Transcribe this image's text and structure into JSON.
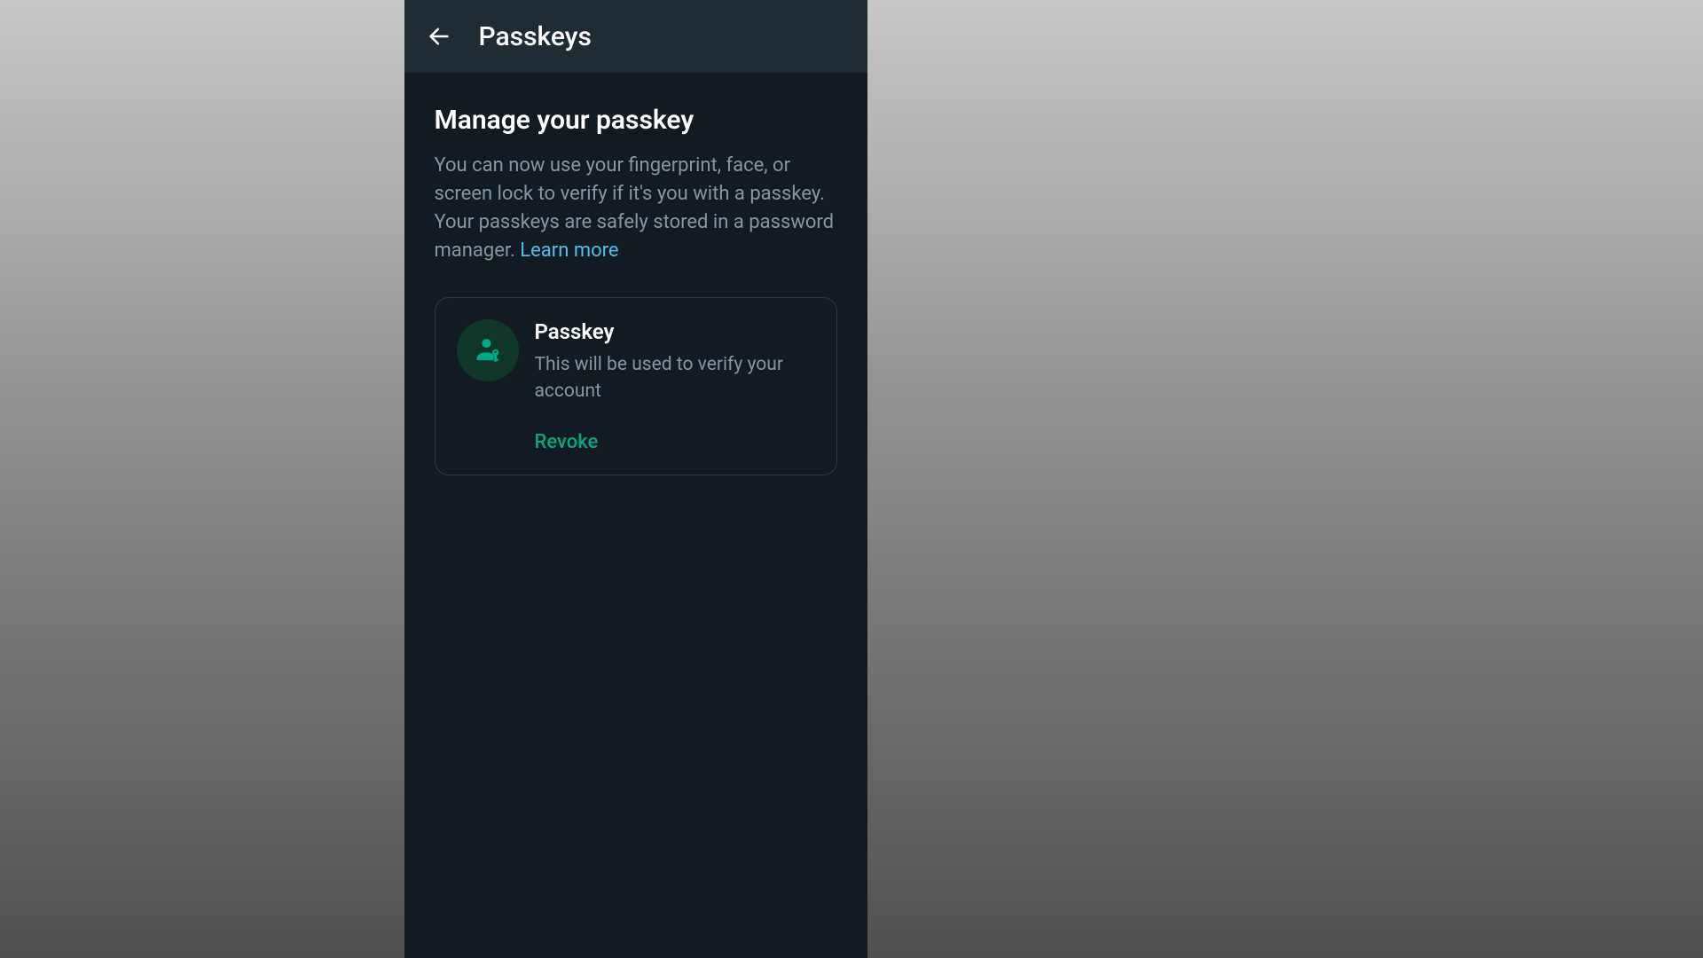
{
  "header": {
    "title": "Passkeys"
  },
  "manage": {
    "title": "Manage your passkey",
    "description": "You can now use your fingerprint, face, or screen lock to verify if it's you with a passkey. Your passkeys are safely stored in a password manager. ",
    "learn_more": "Learn more"
  },
  "passkey_card": {
    "title": "Passkey",
    "subtitle": "This will be used to verify your account",
    "revoke": "Revoke"
  }
}
